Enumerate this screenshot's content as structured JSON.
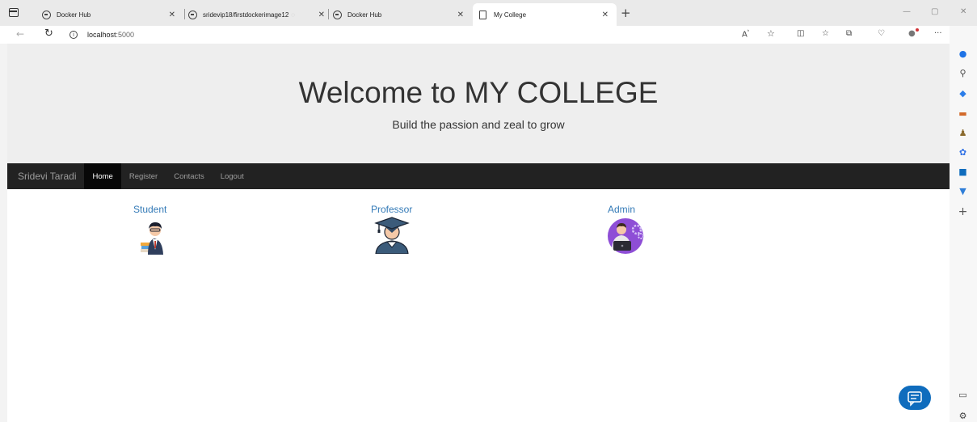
{
  "browser": {
    "tabs": [
      {
        "label": "Docker Hub",
        "active": false
      },
      {
        "label": "sridevip18/firstdockerimage12",
        "active": false
      },
      {
        "label": "Docker Hub",
        "active": false
      },
      {
        "label": "My College",
        "active": true
      }
    ],
    "tab_overflow_glyph": "◌",
    "close_glyph": "✕",
    "new_tab_glyph": "+",
    "window_controls": {
      "minimize": "—",
      "restore": "▢",
      "close": "✕"
    },
    "address": {
      "host": "localhost",
      "port": ":5000"
    },
    "toolbar_icons": [
      "read-aloud-icon",
      "favorite-star-icon",
      "split-screen-icon",
      "favorites-icon",
      "collections-icon",
      "browser-essentials-icon",
      "profile-icon",
      "more-icon",
      "copilot-icon"
    ]
  },
  "page": {
    "title": "Welcome to MY COLLEGE",
    "subtitle": "Build the passion and zeal to grow",
    "navbar": {
      "brand": "Sridevi Taradi",
      "items": [
        {
          "label": "Home",
          "active": true
        },
        {
          "label": "Register",
          "active": false
        },
        {
          "label": "Contacts",
          "active": false
        },
        {
          "label": "Logout",
          "active": false
        }
      ]
    },
    "cards": [
      {
        "label": "Student"
      },
      {
        "label": "Professor"
      },
      {
        "label": "Admin"
      }
    ]
  },
  "colors": {
    "accent_link": "#337ab7",
    "navbar_bg": "#222222",
    "jumbotron_bg": "#eeeeee",
    "chat_button": "#0f6cbd"
  }
}
